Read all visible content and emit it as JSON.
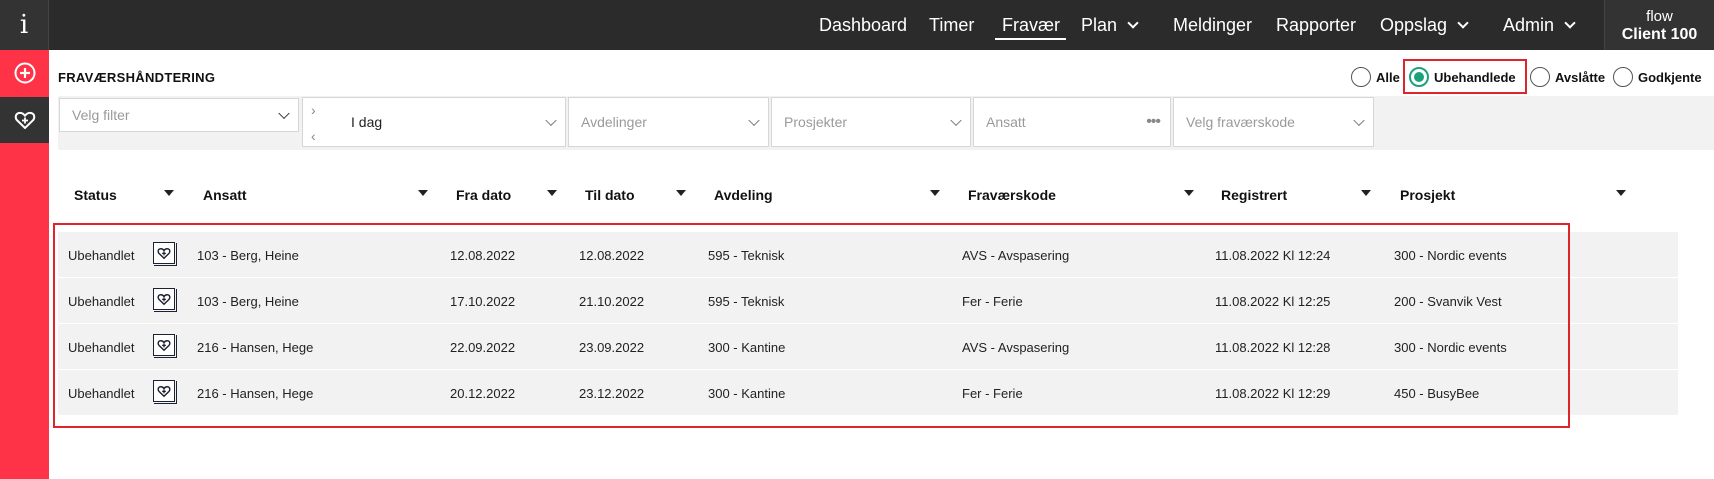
{
  "app": {
    "logo_letter": "i",
    "brand": "flow",
    "client": "Client 100"
  },
  "nav": {
    "items": [
      {
        "label": "Dashboard",
        "has_dropdown": false,
        "active": false
      },
      {
        "label": "Timer",
        "has_dropdown": false,
        "active": false
      },
      {
        "label": "Fravær",
        "has_dropdown": false,
        "active": true
      },
      {
        "label": "Plan",
        "has_dropdown": true,
        "active": false
      },
      {
        "label": "Meldinger",
        "has_dropdown": false,
        "active": false
      },
      {
        "label": "Rapporter",
        "has_dropdown": false,
        "active": false
      },
      {
        "label": "Oppslag",
        "has_dropdown": true,
        "active": false
      },
      {
        "label": "Admin",
        "has_dropdown": true,
        "active": false
      }
    ]
  },
  "sidebar": {
    "items": [
      {
        "icon": "plus-circle-icon",
        "active": false
      },
      {
        "icon": "heart-plus-icon",
        "active": true
      }
    ]
  },
  "page": {
    "title": "FRAVÆRSHÅNDTERING"
  },
  "status_filter": {
    "options": [
      {
        "label": "Alle",
        "checked": false
      },
      {
        "label": "Ubehandlede",
        "checked": true
      },
      {
        "label": "Avslåtte",
        "checked": false
      },
      {
        "label": "Godkjente",
        "checked": false
      }
    ]
  },
  "filters": {
    "filter_placeholder": "Velg filter",
    "date_value": "I dag",
    "department_placeholder": "Avdelinger",
    "project_placeholder": "Prosjekter",
    "employee_placeholder": "Ansatt",
    "absence_code_placeholder": "Velg fraværskode"
  },
  "table": {
    "columns": [
      "Status",
      "Ansatt",
      "Fra dato",
      "Til dato",
      "Avdeling",
      "Fraværskode",
      "Registrert",
      "Prosjekt"
    ],
    "rows": [
      {
        "status": "Ubehandlet",
        "employee": "103 - Berg, Heine",
        "from": "12.08.2022",
        "to": "12.08.2022",
        "department": "595 - Teknisk",
        "code": "AVS - Avspasering",
        "registered": "11.08.2022 Kl 12:24",
        "project": "300 - Nordic events"
      },
      {
        "status": "Ubehandlet",
        "employee": "103 - Berg, Heine",
        "from": "17.10.2022",
        "to": "21.10.2022",
        "department": "595 - Teknisk",
        "code": "Fer - Ferie",
        "registered": "11.08.2022 Kl 12:25",
        "project": "200 - Svanvik Vest"
      },
      {
        "status": "Ubehandlet",
        "employee": "216 - Hansen, Hege",
        "from": "22.09.2022",
        "to": "23.09.2022",
        "department": "300 - Kantine",
        "code": "AVS - Avspasering",
        "registered": "11.08.2022 Kl 12:28",
        "project": "300 - Nordic events"
      },
      {
        "status": "Ubehandlet",
        "employee": "216 - Hansen, Hege",
        "from": "20.12.2022",
        "to": "23.12.2022",
        "department": "300 - Kantine",
        "code": "Fer - Ferie",
        "registered": "11.08.2022 Kl 12:29",
        "project": "450 - BusyBee"
      }
    ]
  },
  "colors": {
    "topbar": "#2b2b2b",
    "sidebar": "#ff3347",
    "accent_green": "#1aa37a",
    "highlight_red": "#e0242c"
  }
}
